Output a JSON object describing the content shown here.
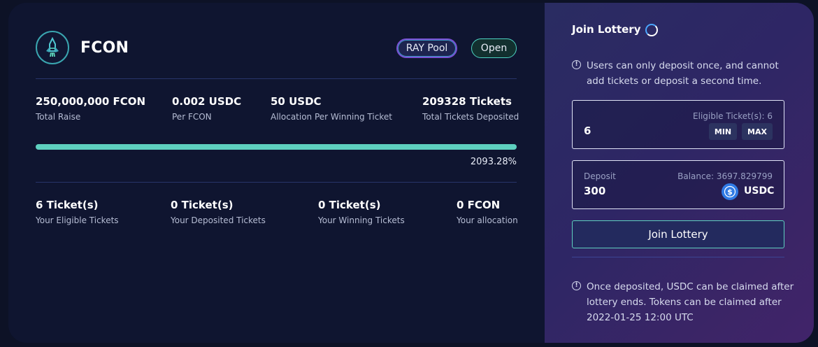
{
  "pool": {
    "token_name": "FCON",
    "badges": {
      "pool": "RAY Pool",
      "status": "Open"
    },
    "stats": [
      {
        "value": "250,000,000 FCON",
        "label": "Total Raise"
      },
      {
        "value": "0.002 USDC",
        "label": "Per FCON"
      },
      {
        "value": "50 USDC",
        "label": "Allocation Per Winning Ticket"
      },
      {
        "value": "209328 Tickets",
        "label": "Total Tickets Deposited"
      }
    ],
    "progress": {
      "percent_text": "2093.28%",
      "fill_fraction": 1.0
    },
    "user_stats": [
      {
        "value": "6 Ticket(s)",
        "label": "Your Eligible Tickets"
      },
      {
        "value": "0 Ticket(s)",
        "label": "Your Deposited Tickets"
      },
      {
        "value": "0 Ticket(s)",
        "label": "Your Winning Tickets"
      },
      {
        "value": "0 FCON",
        "label": "Your allocation"
      }
    ]
  },
  "join": {
    "title": "Join Lottery",
    "notice_top": "Users can only deposit once, and cannot add tickets or deposit a second time.",
    "tickets": {
      "eligible_label": "Eligible Ticket(s): 6",
      "value": "6",
      "min_label": "MIN",
      "max_label": "MAX"
    },
    "deposit": {
      "label": "Deposit",
      "balance_label": "Balance: 3697.829799",
      "value": "300",
      "currency": "USDC"
    },
    "button_label": "Join Lottery",
    "notice_bottom": "Once deposited, USDC can be claimed after lottery ends. Tokens can be claimed after 2022-01-25 12:00 UTC"
  },
  "colors": {
    "accent": "#5ed0bf",
    "panel_left": "#0f1530",
    "panel_right": "#2e2665",
    "usdc_blue": "#2f7ae5"
  },
  "icons": [
    "rocket-logo-icon",
    "spinner-icon",
    "info-icon",
    "usdc-icon"
  ]
}
